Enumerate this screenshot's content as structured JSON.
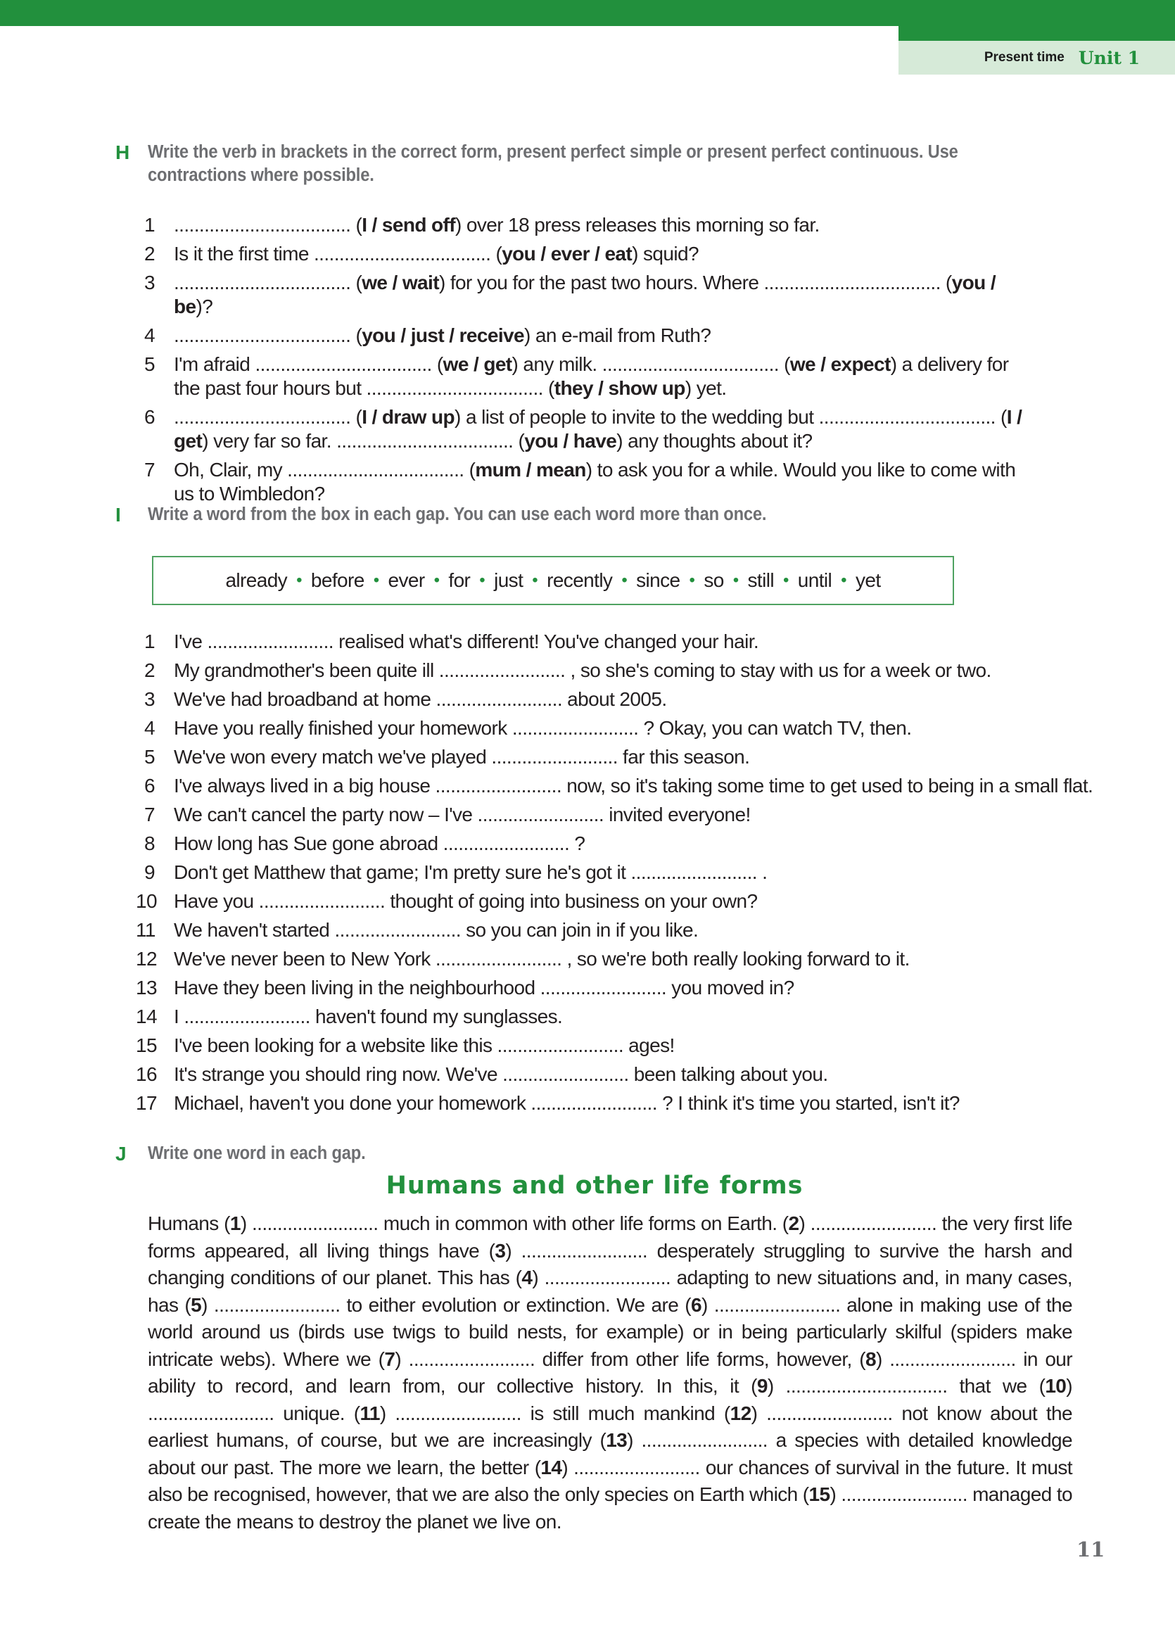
{
  "header": {
    "section": "Present time",
    "unit": "Unit 1"
  },
  "exercise_h": {
    "letter": "H",
    "instruction": "Write the verb in brackets in the correct form, present perfect simple or present perfect continuous. Use contractions where possible.",
    "items": [
      {
        "n": "1",
        "parts": [
          "................................... (",
          "I / send off",
          ") over 18 press releases this morning so far."
        ]
      },
      {
        "n": "2",
        "parts": [
          "Is it the first time ................................... (",
          "you / ever / eat",
          ") squid?"
        ]
      },
      {
        "n": "3",
        "parts": [
          "................................... (",
          "we / wait",
          ") for you for the past two hours. Where ................................... (",
          "you / be",
          ")?"
        ]
      },
      {
        "n": "4",
        "parts": [
          "................................... (",
          "you / just / receive",
          ") an e-mail from Ruth?"
        ]
      },
      {
        "n": "5",
        "parts": [
          "I'm afraid ................................... (",
          "we / get",
          ") any milk. ................................... (",
          "we / expect",
          ") a delivery for the past four hours but ................................... (",
          "they / show up",
          ") yet."
        ]
      },
      {
        "n": "6",
        "parts": [
          "................................... (",
          "I / draw up",
          ") a list of people to invite to the wedding but ................................... (",
          "I / get",
          ") very far so far. ................................... (",
          "you / have",
          ") any thoughts about it?"
        ]
      },
      {
        "n": "7",
        "parts": [
          "Oh, Clair, my ................................... (",
          "mum / mean",
          ") to ask you for a while. Would you like to come with us to Wimbledon?"
        ]
      }
    ]
  },
  "exercise_i": {
    "letter": "I",
    "instruction": "Write a word from the box in each gap. You can use each word more than once.",
    "words": [
      "already",
      "before",
      "ever",
      "for",
      "just",
      "recently",
      "since",
      "so",
      "still",
      "until",
      "yet"
    ],
    "items": [
      {
        "n": "1",
        "text": "I've ......................... realised what's different! You've changed your hair."
      },
      {
        "n": "2",
        "text": "My grandmother's been quite ill ......................... , so she's coming to stay with us for a week or two."
      },
      {
        "n": "3",
        "text": "We've had broadband at home ......................... about 2005."
      },
      {
        "n": "4",
        "text": "Have you really finished your homework ......................... ? Okay, you can watch TV, then."
      },
      {
        "n": "5",
        "text": "We've won every match we've played ......................... far this season."
      },
      {
        "n": "6",
        "text": "I've always lived in a big house ......................... now, so it's taking some time to get used to being in a small flat."
      },
      {
        "n": "7",
        "text": "We can't cancel the party now – I've ......................... invited everyone!"
      },
      {
        "n": "8",
        "text": "How long has Sue gone abroad ......................... ?"
      },
      {
        "n": "9",
        "text": "Don't get Matthew that game; I'm pretty sure he's got it ......................... ."
      },
      {
        "n": "10",
        "text": "Have you ......................... thought of going into business on your own?"
      },
      {
        "n": "11",
        "text": "We haven't started ......................... so you can join in if you like."
      },
      {
        "n": "12",
        "text": "We've never been to New York ......................... , so we're both really looking forward to it."
      },
      {
        "n": "13",
        "text": "Have they been living in the neighbourhood ......................... you moved in?"
      },
      {
        "n": "14",
        "text": "I ......................... haven't found my sunglasses."
      },
      {
        "n": "15",
        "text": "I've been looking for a website like this ......................... ages!"
      },
      {
        "n": "16",
        "text": "It's strange you should ring now. We've ......................... been talking about you."
      },
      {
        "n": "17",
        "text": "Michael, haven't you done your homework ......................... ? I think it's time you started, isn't it?"
      }
    ]
  },
  "exercise_j": {
    "letter": "J",
    "instruction": "Write one word in each gap.",
    "title": "Humans and other life forms",
    "passage": [
      "Humans (",
      "1",
      ") ......................... much in common with other life forms on Earth. (",
      "2",
      ") ......................... the very first life forms appeared, all living things have (",
      "3",
      ") ......................... desperately struggling to survive the harsh and changing conditions of our planet. This has (",
      "4",
      ") ......................... adapting to new situations and, in many cases, has (",
      "5",
      ") ......................... to either evolution or extinction. We are (",
      "6",
      ") ......................... alone in making use of the world around us (birds use twigs to build nests, for example) or in being particularly skilful (spiders make intricate webs). Where we (",
      "7",
      ") ......................... differ from other life forms, however, (",
      "8",
      ") ......................... in our ability to record, and learn from, our collective history. In this, it (",
      "9",
      ") ................................ that we (",
      "10",
      ") ......................... unique. (",
      "11",
      ") ......................... is still much mankind (",
      "12",
      ") ......................... not know about the earliest humans, of course, but we are increasingly (",
      "13",
      ") ......................... a species with detailed knowledge about our past. The more we learn, the better (",
      "14",
      ") ......................... our chances of survival in the future. It must also be recognised, however, that we are also the only species on Earth which (",
      "15",
      ") ......................... managed to create the means to destroy the planet we live on."
    ]
  },
  "page_number": "11"
}
